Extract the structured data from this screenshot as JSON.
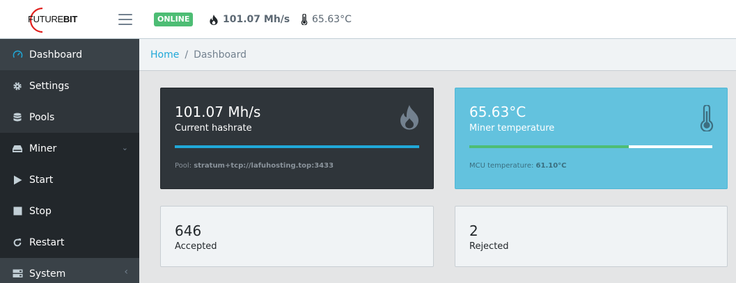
{
  "header": {
    "brand_left": "FUTURE",
    "brand_right": "BIT",
    "status_badge": "ONLINE",
    "hashrate": "101.07 Mh/s",
    "temperature": "65.63°C"
  },
  "sidebar": {
    "items": [
      {
        "label": "Dashboard",
        "icon": "speedometer-icon"
      },
      {
        "label": "Settings",
        "icon": "gear-icon"
      },
      {
        "label": "Pools",
        "icon": "database-icon"
      },
      {
        "label": "Miner",
        "icon": "drive-icon"
      },
      {
        "label": "Start",
        "icon": "play-icon"
      },
      {
        "label": "Stop",
        "icon": "stop-icon"
      },
      {
        "label": "Restart",
        "icon": "restart-icon"
      },
      {
        "label": "System",
        "icon": "server-icon"
      }
    ]
  },
  "breadcrumb": {
    "home": "Home",
    "separator": "/",
    "current": "Dashboard"
  },
  "cards": {
    "hashrate": {
      "value": "101.07 Mh/s",
      "label": "Current hashrate",
      "footer_prefix": "Pool:",
      "footer_value": "stratum+tcp://lafuhosting.top:3433",
      "progress_fraction": 1.0
    },
    "temperature": {
      "value": "65.63°C",
      "label": "Miner temperature",
      "footer_prefix": "MCU temperature:",
      "footer_value": "61.10°C",
      "progress_fraction": 0.656
    },
    "accepted": {
      "value": "646",
      "label": "Accepted"
    },
    "rejected": {
      "value": "2",
      "label": "Rejected"
    }
  },
  "colors": {
    "online": "#4dbd74",
    "sidebar_bg": "#2f353a",
    "accent": "#20a8d8",
    "info_card": "#63c2de"
  }
}
